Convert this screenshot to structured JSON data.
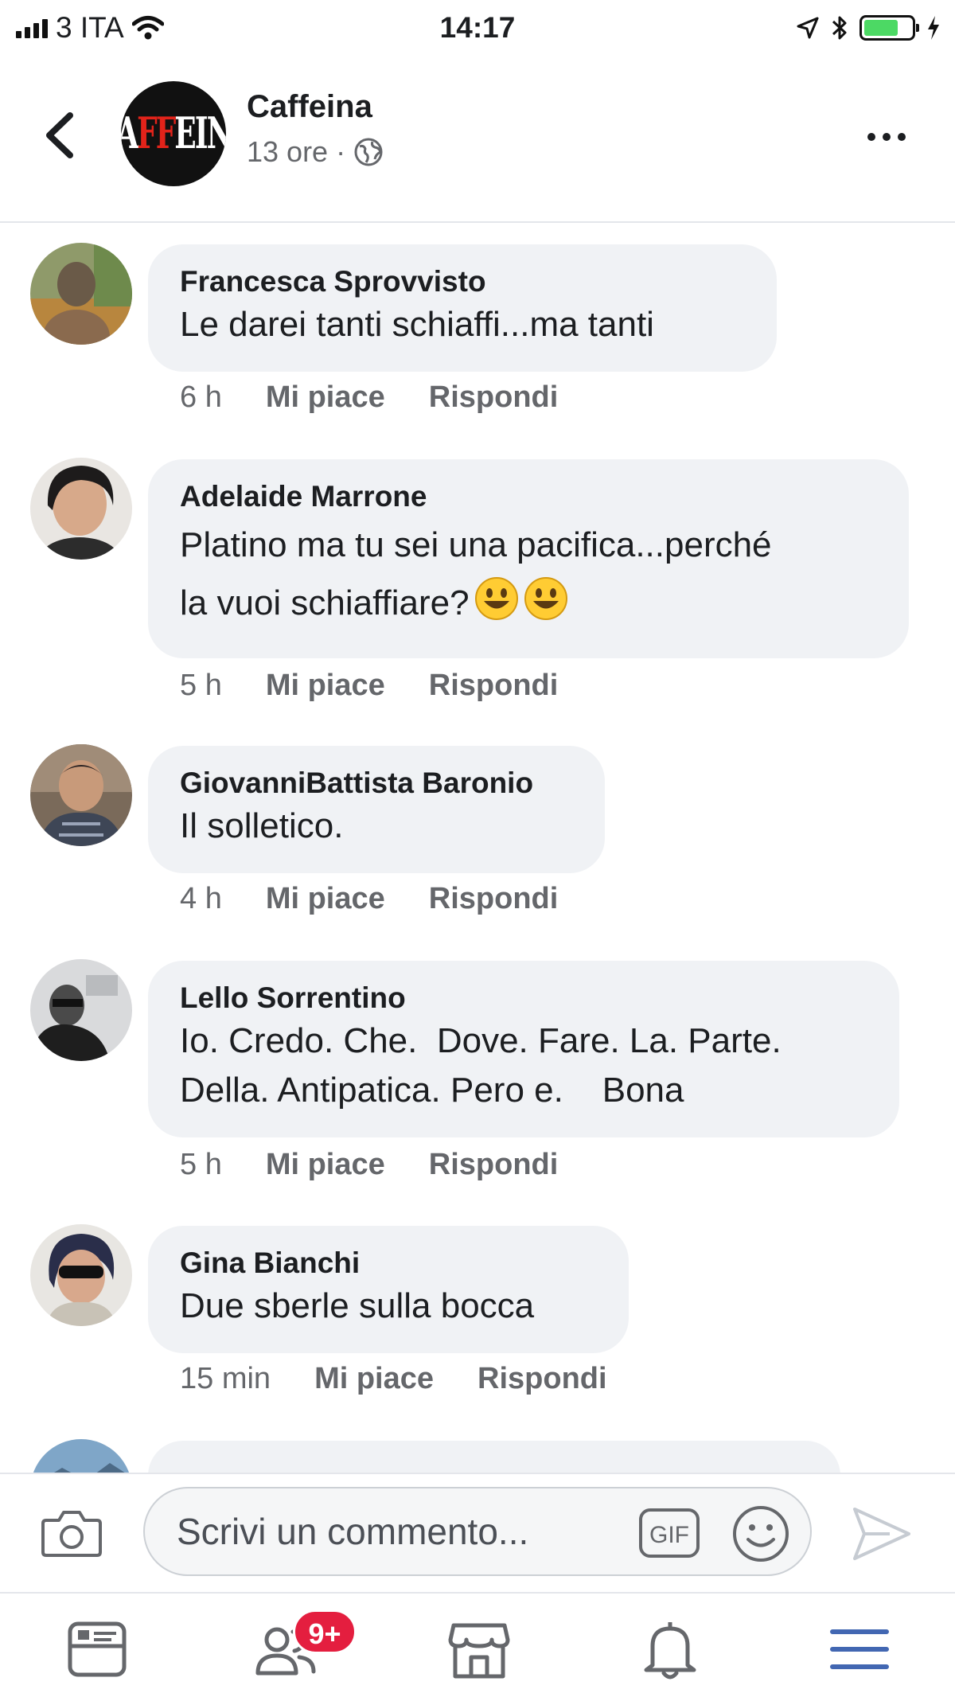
{
  "status_bar": {
    "carrier": "3 ITA",
    "time": "14:17"
  },
  "header": {
    "page_name": "Caffeina",
    "post_time": "13 ore",
    "separator": "·"
  },
  "comments": [
    {
      "author": "Francesca Sprovvisto",
      "text": "Le darei tanti schiaffi...ma tanti",
      "time": "6 h",
      "like": "Mi piace",
      "reply": "Rispondi"
    },
    {
      "author": "Adelaide Marrone",
      "text_line1": "Platino ma tu sei una pacifica...perché",
      "text_line2": "la vuoi schiaffiare?",
      "time": "5 h",
      "like": "Mi piace",
      "reply": "Rispondi"
    },
    {
      "author": "GiovanniBattista Baronio",
      "text": "Il solletico.",
      "time": "4 h",
      "like": "Mi piace",
      "reply": "Rispondi"
    },
    {
      "author": "Lello Sorrentino",
      "text_line1": "Io. Credo. Che.  Dove. Fare. La. Parte.",
      "text_line2": "Della. Antipatica. Pero e.    Bona",
      "time": "5 h",
      "like": "Mi piace",
      "reply": "Rispondi"
    },
    {
      "author": "Gina Bianchi",
      "text": "Due sberle sulla bocca",
      "time": "15 min",
      "like": "Mi piace",
      "reply": "Rispondi"
    }
  ],
  "composer": {
    "placeholder": "Scrivi un commento...",
    "gif_label": "GIF"
  },
  "tabbar": {
    "friends_badge": "9+",
    "active_tab": "menu",
    "accent_color": "#4267b2"
  }
}
